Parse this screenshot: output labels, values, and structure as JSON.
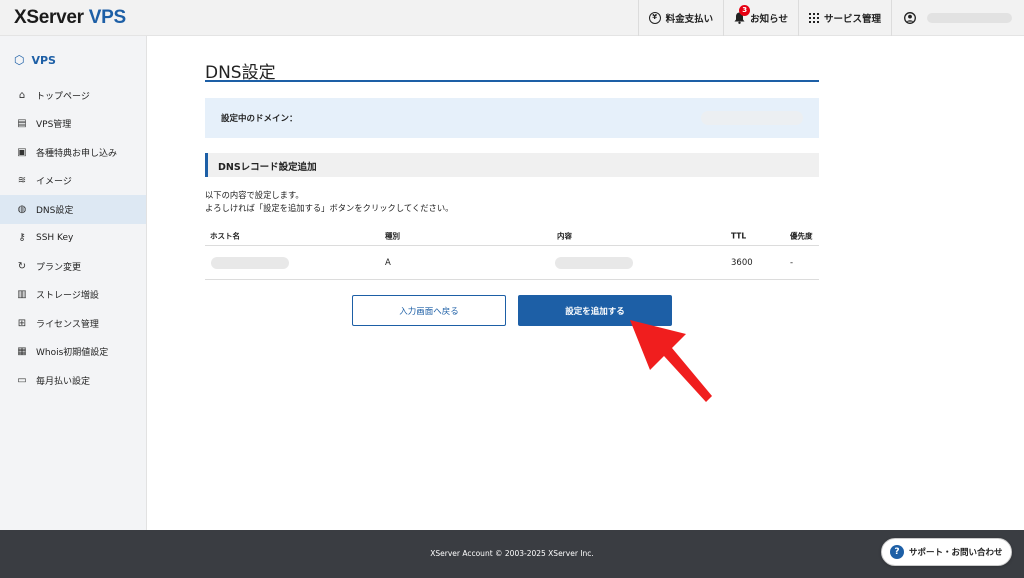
{
  "header": {
    "logo_main": "XServer",
    "logo_accent": "VPS",
    "nav": [
      {
        "label": "料金支払い",
        "icon": "yen-circle-icon"
      },
      {
        "label": "お知らせ",
        "icon": "bell-icon",
        "badge": "3"
      },
      {
        "label": "サービス管理",
        "icon": "grid-icon"
      }
    ]
  },
  "sidebar": {
    "title": "VPS",
    "items": [
      {
        "label": "トップページ",
        "icon": "home-icon"
      },
      {
        "label": "VPS管理",
        "icon": "server-icon"
      },
      {
        "label": "各種特典お申し込み",
        "icon": "gift-icon"
      },
      {
        "label": "イメージ",
        "icon": "layers-icon"
      },
      {
        "label": "DNS設定",
        "icon": "globe-icon",
        "active": true
      },
      {
        "label": "SSH Key",
        "icon": "key-icon"
      },
      {
        "label": "プラン変更",
        "icon": "refresh-icon"
      },
      {
        "label": "ストレージ増設",
        "icon": "storage-icon"
      },
      {
        "label": "ライセンス管理",
        "icon": "windows-icon"
      },
      {
        "label": "Whois初期値設定",
        "icon": "document-icon"
      },
      {
        "label": "毎月払い設定",
        "icon": "card-icon"
      }
    ]
  },
  "main": {
    "title": "DNS設定",
    "domain_label": "設定中のドメイン：",
    "section_title": "DNSレコード設定追加",
    "desc_line1": "以下の内容で設定します。",
    "desc_line2": "よろしければ「設定を追加する」ボタンをクリックしてください。",
    "table": {
      "headers": [
        "ホスト名",
        "種別",
        "内容",
        "TTL",
        "優先度"
      ],
      "row": {
        "type": "A",
        "ttl": "3600",
        "priority": "-"
      }
    },
    "back_button": "入力画面へ戻る",
    "submit_button": "設定を追加する"
  },
  "footer": {
    "copyright": "XServer Account © 2003-2025 XServer Inc.",
    "support": "サポート・お問い合わせ"
  },
  "colors": {
    "accent": "#1d5fa6",
    "arrow": "#f01e1e"
  }
}
